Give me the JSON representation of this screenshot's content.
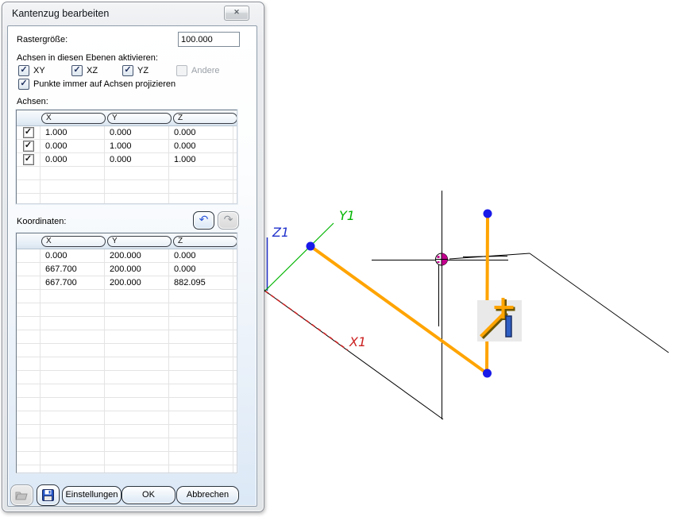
{
  "window": {
    "title": "Kantenzug bearbeiten"
  },
  "icons": {
    "close": "✕",
    "undo": "↶",
    "redo": "↷",
    "check": "✓"
  },
  "raster": {
    "label": "Rastergröße:",
    "value": "100.000"
  },
  "planes": {
    "label": "Achsen in diesen Ebenen aktivieren:",
    "options": [
      {
        "label": "XY",
        "checked": true,
        "enabled": true
      },
      {
        "label": "XZ",
        "checked": true,
        "enabled": true
      },
      {
        "label": "YZ",
        "checked": true,
        "enabled": true
      },
      {
        "label": "Andere",
        "checked": false,
        "enabled": false
      }
    ]
  },
  "project": {
    "label": "Punkte immer auf Achsen projizieren",
    "checked": true
  },
  "axes_table": {
    "label": "Achsen:",
    "columns": [
      "X",
      "Y",
      "Z"
    ],
    "rows": [
      {
        "checked": true,
        "x": "1.000",
        "y": "0.000",
        "z": "0.000"
      },
      {
        "checked": true,
        "x": "0.000",
        "y": "1.000",
        "z": "0.000"
      },
      {
        "checked": true,
        "x": "0.000",
        "y": "0.000",
        "z": "1.000"
      }
    ]
  },
  "coords_table": {
    "label": "Koordinaten:",
    "columns": [
      "X",
      "Y",
      "Z"
    ],
    "rows": [
      {
        "x": "0.000",
        "y": "200.000",
        "z": "0.000"
      },
      {
        "x": "667.700",
        "y": "200.000",
        "z": "0.000"
      },
      {
        "x": "667.700",
        "y": "200.000",
        "z": "882.095"
      }
    ]
  },
  "buttons": {
    "settings": "Einstellungen",
    "ok": "OK",
    "cancel": "Abbrechen"
  },
  "viewport": {
    "axis_labels": {
      "x": "X1",
      "y": "Y1",
      "z": "Z1"
    },
    "colors": {
      "x_axis": "#cc2222",
      "y_axis": "#00b400",
      "z_axis": "#2233cc",
      "polyline": "#ffa400",
      "point": "#1a1ae8",
      "snap": "#c4008f",
      "badge_bg": "#e9e9e9",
      "badge_blue": "#2e5fc4"
    }
  }
}
